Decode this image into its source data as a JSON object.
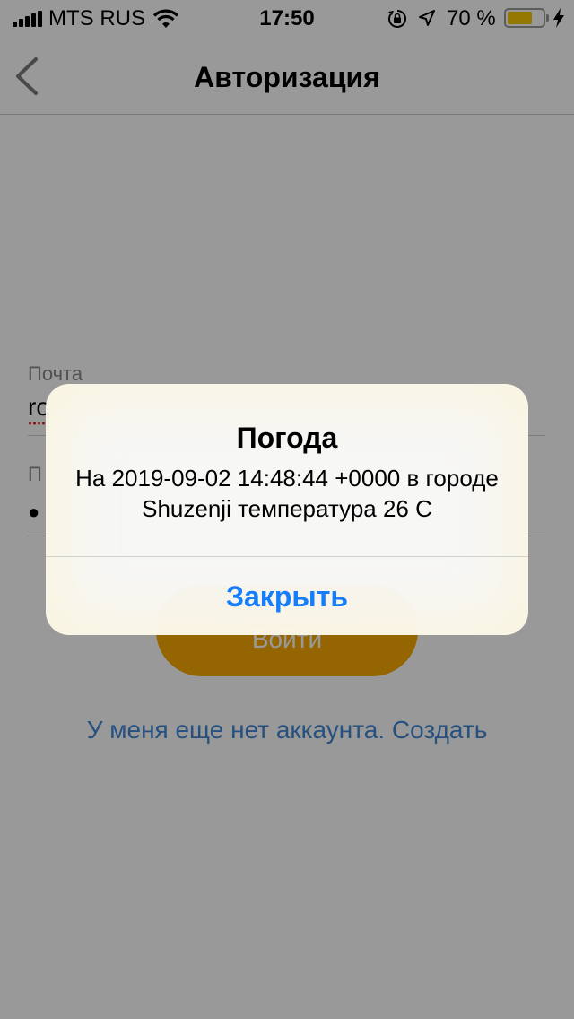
{
  "status_bar": {
    "carrier": "MTS RUS",
    "time": "17:50",
    "battery_percent": "70 %",
    "battery_level": 0.7,
    "battery_color": "#f7c600",
    "icons": [
      "signal-icon",
      "wifi-icon",
      "rotation-lock-icon",
      "location-icon",
      "battery-icon",
      "charging-icon"
    ]
  },
  "nav": {
    "title": "Авторизация",
    "back_icon": "chevron-left-icon"
  },
  "form": {
    "email_label": "Почта",
    "email_value": "ro",
    "password_label": "П",
    "password_value": "●",
    "login_button": "Войти",
    "signup_link": "У меня еще нет аккаунта. Создать"
  },
  "alert": {
    "title": "Погода",
    "message": "На 2019-09-02 14:48:44 +0000 в городе Shuzenji температура 26 С",
    "close_button": "Закрыть"
  },
  "colors": {
    "accent_blue": "#157efb",
    "link_blue": "#3f86d4",
    "button_yellow": "#f7a900"
  }
}
